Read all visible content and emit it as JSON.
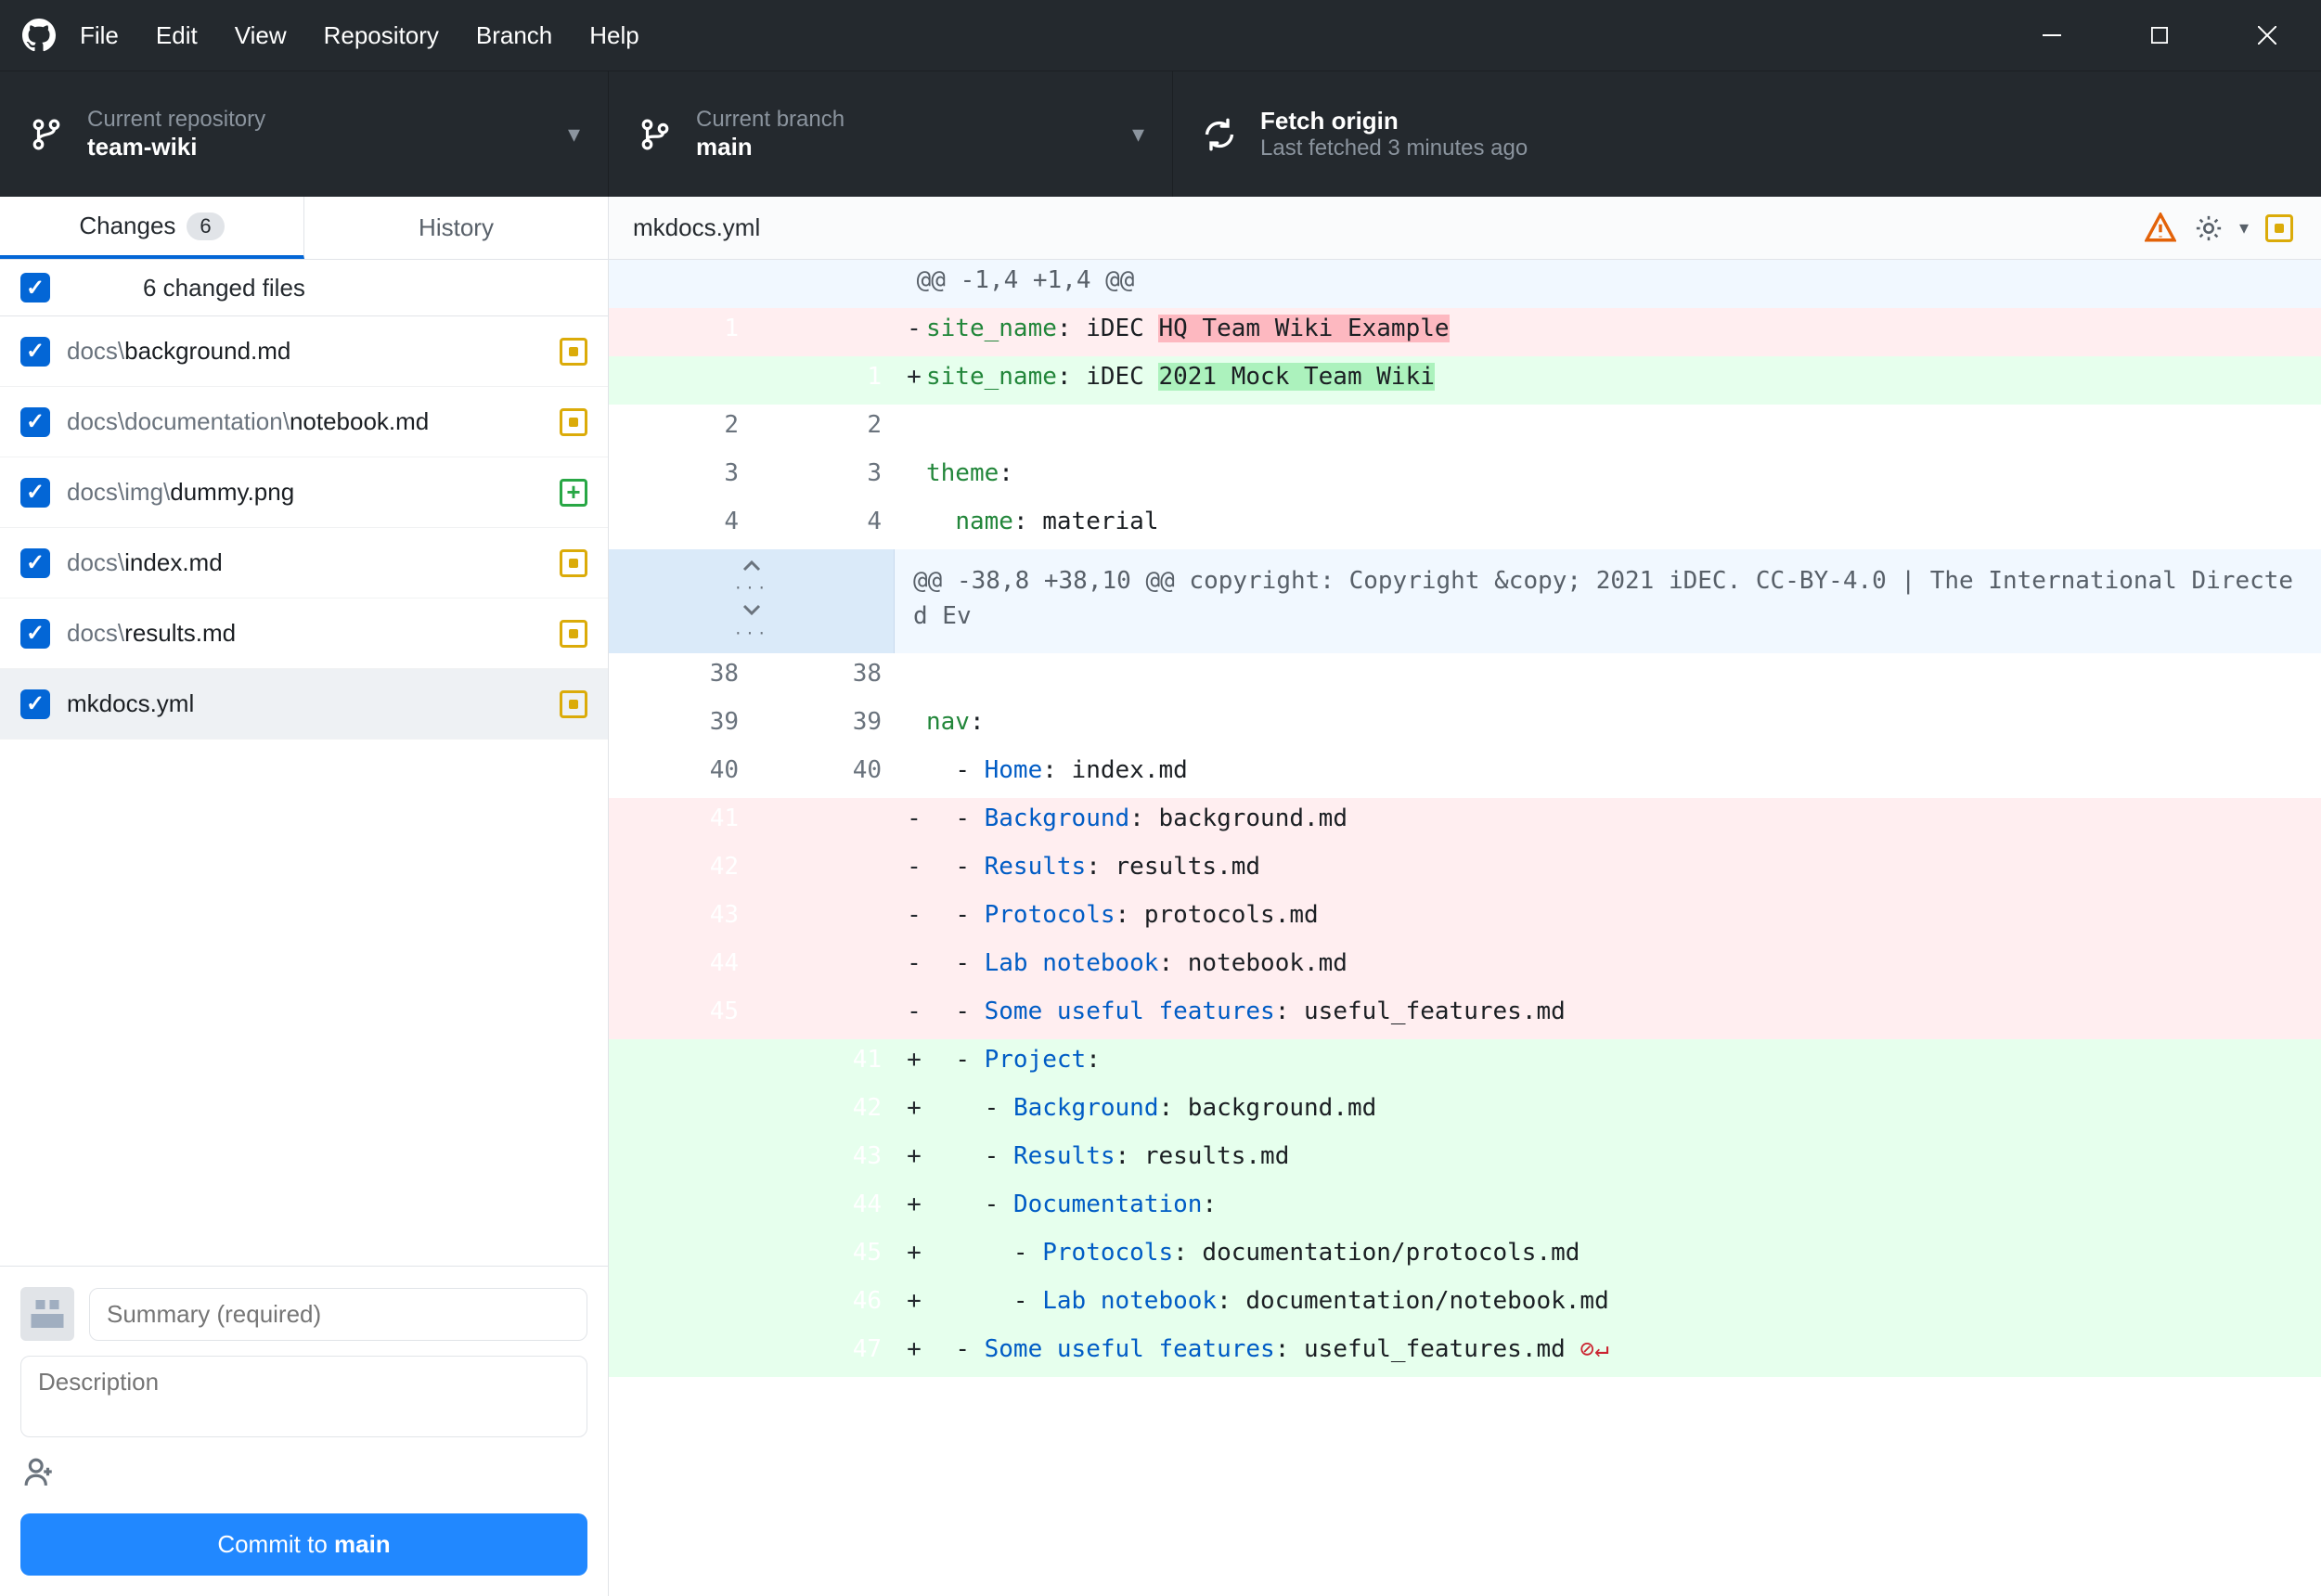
{
  "menu": {
    "items": [
      "File",
      "Edit",
      "View",
      "Repository",
      "Branch",
      "Help"
    ]
  },
  "toolbar": {
    "repo": {
      "label": "Current repository",
      "value": "team-wiki"
    },
    "branch": {
      "label": "Current branch",
      "value": "main"
    },
    "fetch": {
      "label": "Fetch origin",
      "sub": "Last fetched 3 minutes ago"
    }
  },
  "sidebar": {
    "tabs": {
      "changes": "Changes",
      "history": "History",
      "count": "6"
    },
    "files_header": "6 changed files",
    "files": [
      {
        "dir": "docs\\",
        "name": "background.md",
        "status": "mod"
      },
      {
        "dir": "docs\\documentation\\",
        "name": "notebook.md",
        "status": "mod"
      },
      {
        "dir": "docs\\img\\",
        "name": "dummy.png",
        "status": "add"
      },
      {
        "dir": "docs\\",
        "name": "index.md",
        "status": "mod"
      },
      {
        "dir": "docs\\",
        "name": "results.md",
        "status": "mod"
      },
      {
        "dir": "",
        "name": "mkdocs.yml",
        "status": "mod",
        "selected": true
      }
    ],
    "commit": {
      "summary_placeholder": "Summary (required)",
      "description_placeholder": "Description",
      "button_prefix": "Commit to ",
      "button_branch": "main"
    }
  },
  "main": {
    "filename": "mkdocs.yml",
    "diff": {
      "hunk1": "@@ -1,4 +1,4 @@",
      "hunk2": "@@ -38,8 +38,10 @@ copyright: Copyright &copy; 2021 iDEC. CC-BY-4.0 | The International Directed Ev",
      "lines": [
        {
          "type": "hunk",
          "ref": "hunk1"
        },
        {
          "type": "del",
          "old": "1",
          "new": "",
          "key": "site_name",
          "plain": " iDEC ",
          "hl": "HQ Team Wiki Example"
        },
        {
          "type": "add",
          "old": "",
          "new": "1",
          "key": "site_name",
          "plain": " iDEC ",
          "hl": "2021 Mock Team Wiki"
        },
        {
          "type": "ctx",
          "old": "2",
          "new": "2",
          "text": ""
        },
        {
          "type": "ctx",
          "old": "3",
          "new": "3",
          "key": "theme",
          "text": ""
        },
        {
          "type": "ctx",
          "old": "4",
          "new": "4",
          "indent": "  ",
          "key": "name",
          "text": " material"
        },
        {
          "type": "hunk-exp",
          "ref": "hunk2"
        },
        {
          "type": "ctx",
          "old": "38",
          "new": "38",
          "text": ""
        },
        {
          "type": "ctx",
          "old": "39",
          "new": "39",
          "key": "nav",
          "text": ""
        },
        {
          "type": "ctx",
          "old": "40",
          "new": "40",
          "indent": "  ",
          "dash": "- ",
          "key": "Home",
          "text": " index.md"
        },
        {
          "type": "del",
          "old": "41",
          "new": "",
          "indent": "  ",
          "dash": "- ",
          "key": "Background",
          "text": " background.md"
        },
        {
          "type": "del",
          "old": "42",
          "new": "",
          "indent": "  ",
          "dash": "- ",
          "key": "Results",
          "text": " results.md"
        },
        {
          "type": "del",
          "old": "43",
          "new": "",
          "indent": "  ",
          "dash": "- ",
          "key": "Protocols",
          "text": " protocols.md"
        },
        {
          "type": "del",
          "old": "44",
          "new": "",
          "indent": "  ",
          "dash": "- ",
          "key": "Lab notebook",
          "text": " notebook.md"
        },
        {
          "type": "del",
          "old": "45",
          "new": "",
          "indent": "  ",
          "dash": "- ",
          "key": "Some useful features",
          "text": " useful_features.md"
        },
        {
          "type": "add",
          "old": "",
          "new": "41",
          "indent": "  ",
          "dash": "- ",
          "key": "Project",
          "text": ""
        },
        {
          "type": "add",
          "old": "",
          "new": "42",
          "indent": "    ",
          "dash": "- ",
          "key": "Background",
          "text": " background.md"
        },
        {
          "type": "add",
          "old": "",
          "new": "43",
          "indent": "    ",
          "dash": "- ",
          "key": "Results",
          "text": " results.md"
        },
        {
          "type": "add",
          "old": "",
          "new": "44",
          "indent": "    ",
          "dash": "- ",
          "key": "Documentation",
          "text": ""
        },
        {
          "type": "add",
          "old": "",
          "new": "45",
          "indent": "      ",
          "dash": "- ",
          "key": "Protocols",
          "text": " documentation/protocols.md"
        },
        {
          "type": "add",
          "old": "",
          "new": "46",
          "indent": "      ",
          "dash": "- ",
          "key": "Lab notebook",
          "text": " documentation/notebook.md"
        },
        {
          "type": "add",
          "old": "",
          "new": "47",
          "indent": "  ",
          "dash": "- ",
          "key": "Some useful features",
          "text": " useful_features.md",
          "eof": true
        }
      ]
    }
  }
}
